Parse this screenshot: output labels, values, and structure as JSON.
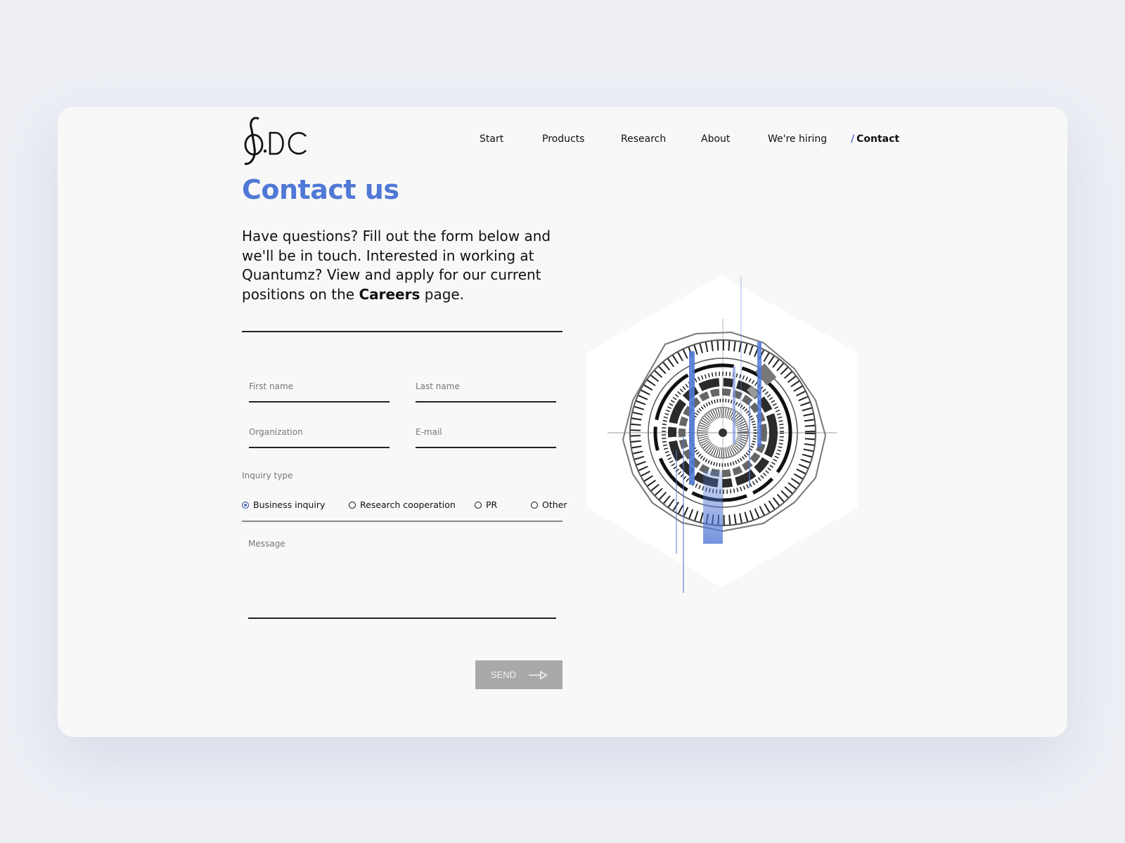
{
  "brand": {
    "logo_text": "∮.DC"
  },
  "nav": {
    "items": [
      "Start",
      "Products",
      "Research",
      "About",
      "We're hiring"
    ],
    "active": {
      "mark": "/",
      "label": "Contact"
    }
  },
  "page": {
    "title": "Contact us",
    "intro_text": "Have questions? Fill out the form below and we'll be in touch. Interested in working at Quantumz? View and apply for our current positions on the",
    "careers_link": "Careers",
    "intro_suffix": "page."
  },
  "form": {
    "first_name": {
      "placeholder": "First name",
      "value": ""
    },
    "last_name": {
      "placeholder": "Last name",
      "value": ""
    },
    "organization": {
      "placeholder": "Organization",
      "value": ""
    },
    "email": {
      "placeholder": "E-mail",
      "value": ""
    },
    "inquiry_label": "Inquiry type",
    "inquiry_options": [
      {
        "label": "Business inquiry",
        "selected": true
      },
      {
        "label": "Research cooperation",
        "selected": false
      },
      {
        "label": "PR",
        "selected": false
      },
      {
        "label": "Other",
        "selected": false
      }
    ],
    "message": {
      "placeholder": "Message",
      "value": ""
    },
    "send_label": "SEND"
  },
  "colors": {
    "accent": "#5078d6",
    "page_bg": "#edeff5",
    "card_bg": "#f8f8f8",
    "button_bg": "#a9a9a9"
  },
  "icons": {
    "send": "arrow-right-icon",
    "illustration": "quantum-core-illustration"
  }
}
